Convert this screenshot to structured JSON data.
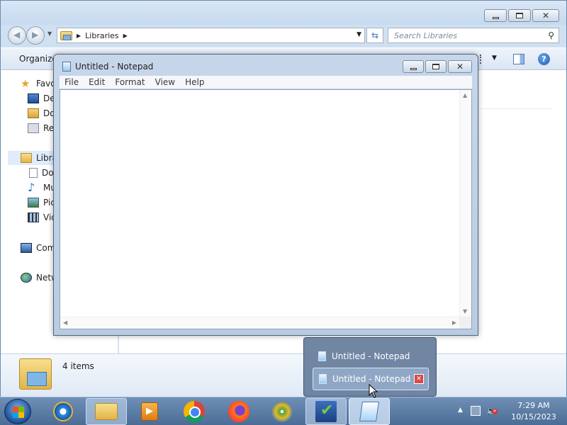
{
  "explorer": {
    "address": {
      "location": "Libraries"
    },
    "search": {
      "placeholder": "Search Libraries"
    },
    "command_bar": {
      "organize": "Organize"
    },
    "nav": {
      "favorites": "Favorites",
      "desktop": "Desktop",
      "downloads": "Downloads",
      "recent": "Recent Places",
      "libraries": "Libraries",
      "documents": "Documents",
      "music": "Music",
      "pictures": "Pictures",
      "videos": "Videos",
      "computer": "Computer",
      "network": "Network"
    },
    "details": {
      "item_count": "4 items"
    }
  },
  "notepad": {
    "title": "Untitled - Notepad",
    "menu": [
      "File",
      "Edit",
      "Format",
      "View",
      "Help"
    ],
    "content": ""
  },
  "thumbnail_popup": {
    "items": [
      {
        "title": "Untitled - Notepad"
      },
      {
        "title": "Untitled - Notepad"
      }
    ]
  },
  "taskbar": {
    "pinned": [
      "internet-explorer",
      "windows-explorer",
      "media-center",
      "google-chrome",
      "firefox",
      "windows-logo",
      "action-center",
      "notepad"
    ],
    "clock": {
      "time": "7:29 AM",
      "date": "10/15/2023"
    }
  },
  "colors": {
    "taskbar": "#4b6c95",
    "window_frame": "#c7d7ea",
    "close_red": "#d84a4a"
  }
}
